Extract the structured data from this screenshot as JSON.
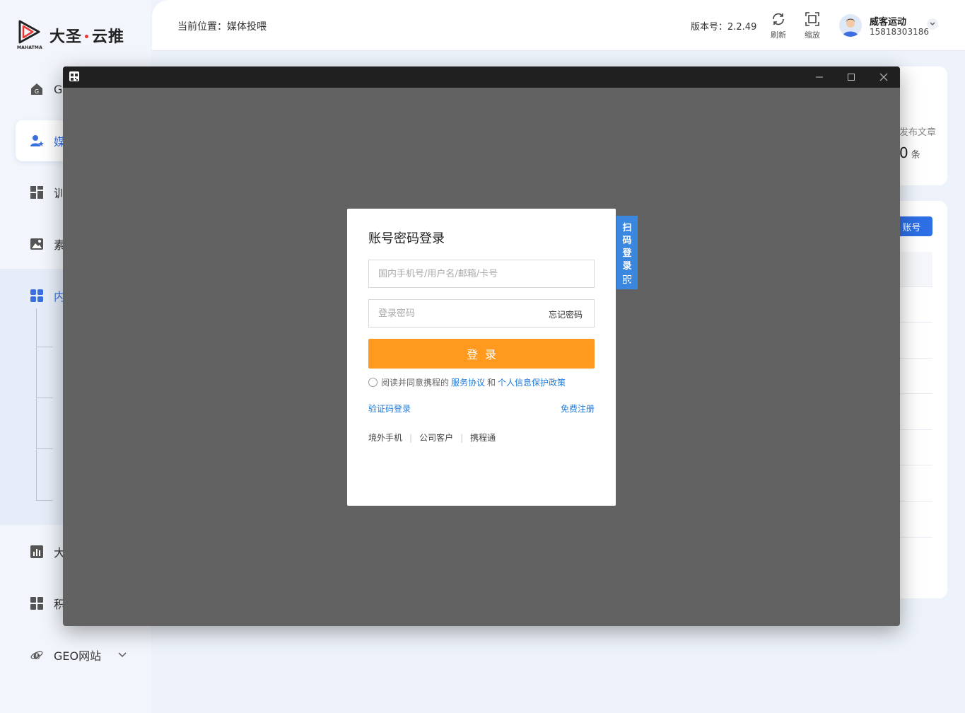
{
  "app": {
    "logo_brand": "大圣",
    "logo_dot": "•",
    "logo_product": "云推",
    "logo_sub": "MAHATMA"
  },
  "sidebar": {
    "items": [
      {
        "label": "G",
        "icon": "home-icon"
      },
      {
        "label": "媒",
        "icon": "user-star-icon",
        "active": true
      },
      {
        "label": "训",
        "icon": "grid-icon"
      },
      {
        "label": "素",
        "icon": "image-icon"
      },
      {
        "label": "内",
        "icon": "grid-icon"
      },
      {
        "label": "大",
        "icon": "bar-chart-icon"
      },
      {
        "label": "积",
        "icon": "grid-icon"
      },
      {
        "label": "GEO网站",
        "icon": "ie-icon"
      }
    ]
  },
  "header": {
    "breadcrumb": "当前位置：媒体投喂",
    "version": "版本号：2.2.49",
    "refresh_label": "刷新",
    "zoom_label": "缩放",
    "user_name": "威客运动",
    "user_phone": "15818303186"
  },
  "content": {
    "stat_label": "发布文章",
    "stat_value": "0",
    "stat_unit": "条",
    "button_label": "账号"
  },
  "login": {
    "title": "账号密码登录",
    "account_placeholder": "国内手机号/用户名/邮箱/卡号",
    "password_placeholder": "登录密码",
    "forgot": "忘记密码",
    "submit": "登录",
    "agree_prefix": "阅读并同意携程的",
    "service_agreement": "服务协议",
    "and": "和",
    "privacy_policy": "个人信息保护政策",
    "sms_login": "验证码登录",
    "register": "免费注册",
    "alt_logins": [
      "境外手机",
      "公司客户",
      "携程通"
    ],
    "qr_tab": [
      "扫",
      "码",
      "登",
      "录"
    ]
  },
  "colors": {
    "accent_blue": "#3b6fe0",
    "login_orange": "#ff9a1f",
    "link_blue": "#1f7ad8",
    "qr_blue": "#3b87e0"
  }
}
